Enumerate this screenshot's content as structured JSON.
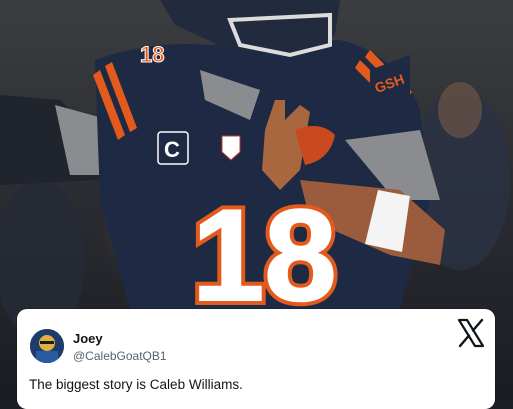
{
  "photo": {
    "description_icon": "player-photo-icon",
    "jersey_number": "18",
    "captain_patch": "C",
    "sleeve_number": "18",
    "helmet_logo": "GSH",
    "colors": {
      "jersey": "#1e2a44",
      "stripe": "#e35a1c",
      "background": "#2a2c30"
    }
  },
  "tweet": {
    "display_name": "Joey",
    "handle": "@CalebGoatQB1",
    "text": "The biggest story is Caleb Williams.",
    "avatar_icon": "profile-avatar-icon",
    "platform_icon": "x-logo-icon"
  }
}
